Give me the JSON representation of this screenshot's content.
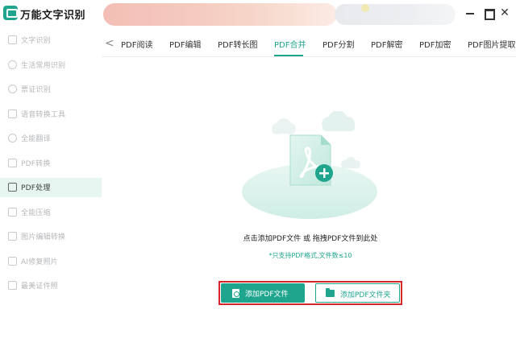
{
  "app": {
    "title": "万能文字识别"
  },
  "window": {
    "minimize": "",
    "maximize": "",
    "close": "✕"
  },
  "sidebar": {
    "items": [
      {
        "label": "文字识别",
        "icon": "text-scan-icon",
        "active": false
      },
      {
        "label": "生活常用识别",
        "icon": "life-scan-icon",
        "active": false
      },
      {
        "label": "票证识别",
        "icon": "ticket-scan-icon",
        "active": false
      },
      {
        "label": "语音转换工具",
        "icon": "voice-convert-icon",
        "active": false
      },
      {
        "label": "全能翻译",
        "icon": "translate-icon",
        "active": false
      },
      {
        "label": "PDF转换",
        "icon": "pdf-convert-icon",
        "active": false
      },
      {
        "label": "PDF处理",
        "icon": "pdf-process-icon",
        "active": true
      },
      {
        "label": "全能压缩",
        "icon": "compress-icon",
        "active": false
      },
      {
        "label": "图片编辑转换",
        "icon": "image-edit-icon",
        "active": false
      },
      {
        "label": "AI修复照片",
        "icon": "ai-photo-fix-icon",
        "active": false
      },
      {
        "label": "最美证件照",
        "icon": "id-photo-icon",
        "active": false
      }
    ]
  },
  "tabs": {
    "back": "<",
    "items": [
      {
        "label": "PDF阅读",
        "active": false
      },
      {
        "label": "PDF编辑",
        "active": false
      },
      {
        "label": "PDF转长图",
        "active": false
      },
      {
        "label": "PDF合并",
        "active": true
      },
      {
        "label": "PDF分割",
        "active": false
      },
      {
        "label": "PDF解密",
        "active": false
      },
      {
        "label": "PDF加密",
        "active": false
      },
      {
        "label": "PDF图片提取",
        "active": false
      }
    ]
  },
  "main": {
    "drop_hint": "点击添加PDF文件 或 拖拽PDF文件到此处",
    "drop_note": "*只支持PDF格式,文件数≤10",
    "add_file_label": "添加PDF文件",
    "add_folder_label": "添加PDF文件夹"
  },
  "colors": {
    "accent": "#1fa58e",
    "highlight_frame": "#d8262b"
  }
}
